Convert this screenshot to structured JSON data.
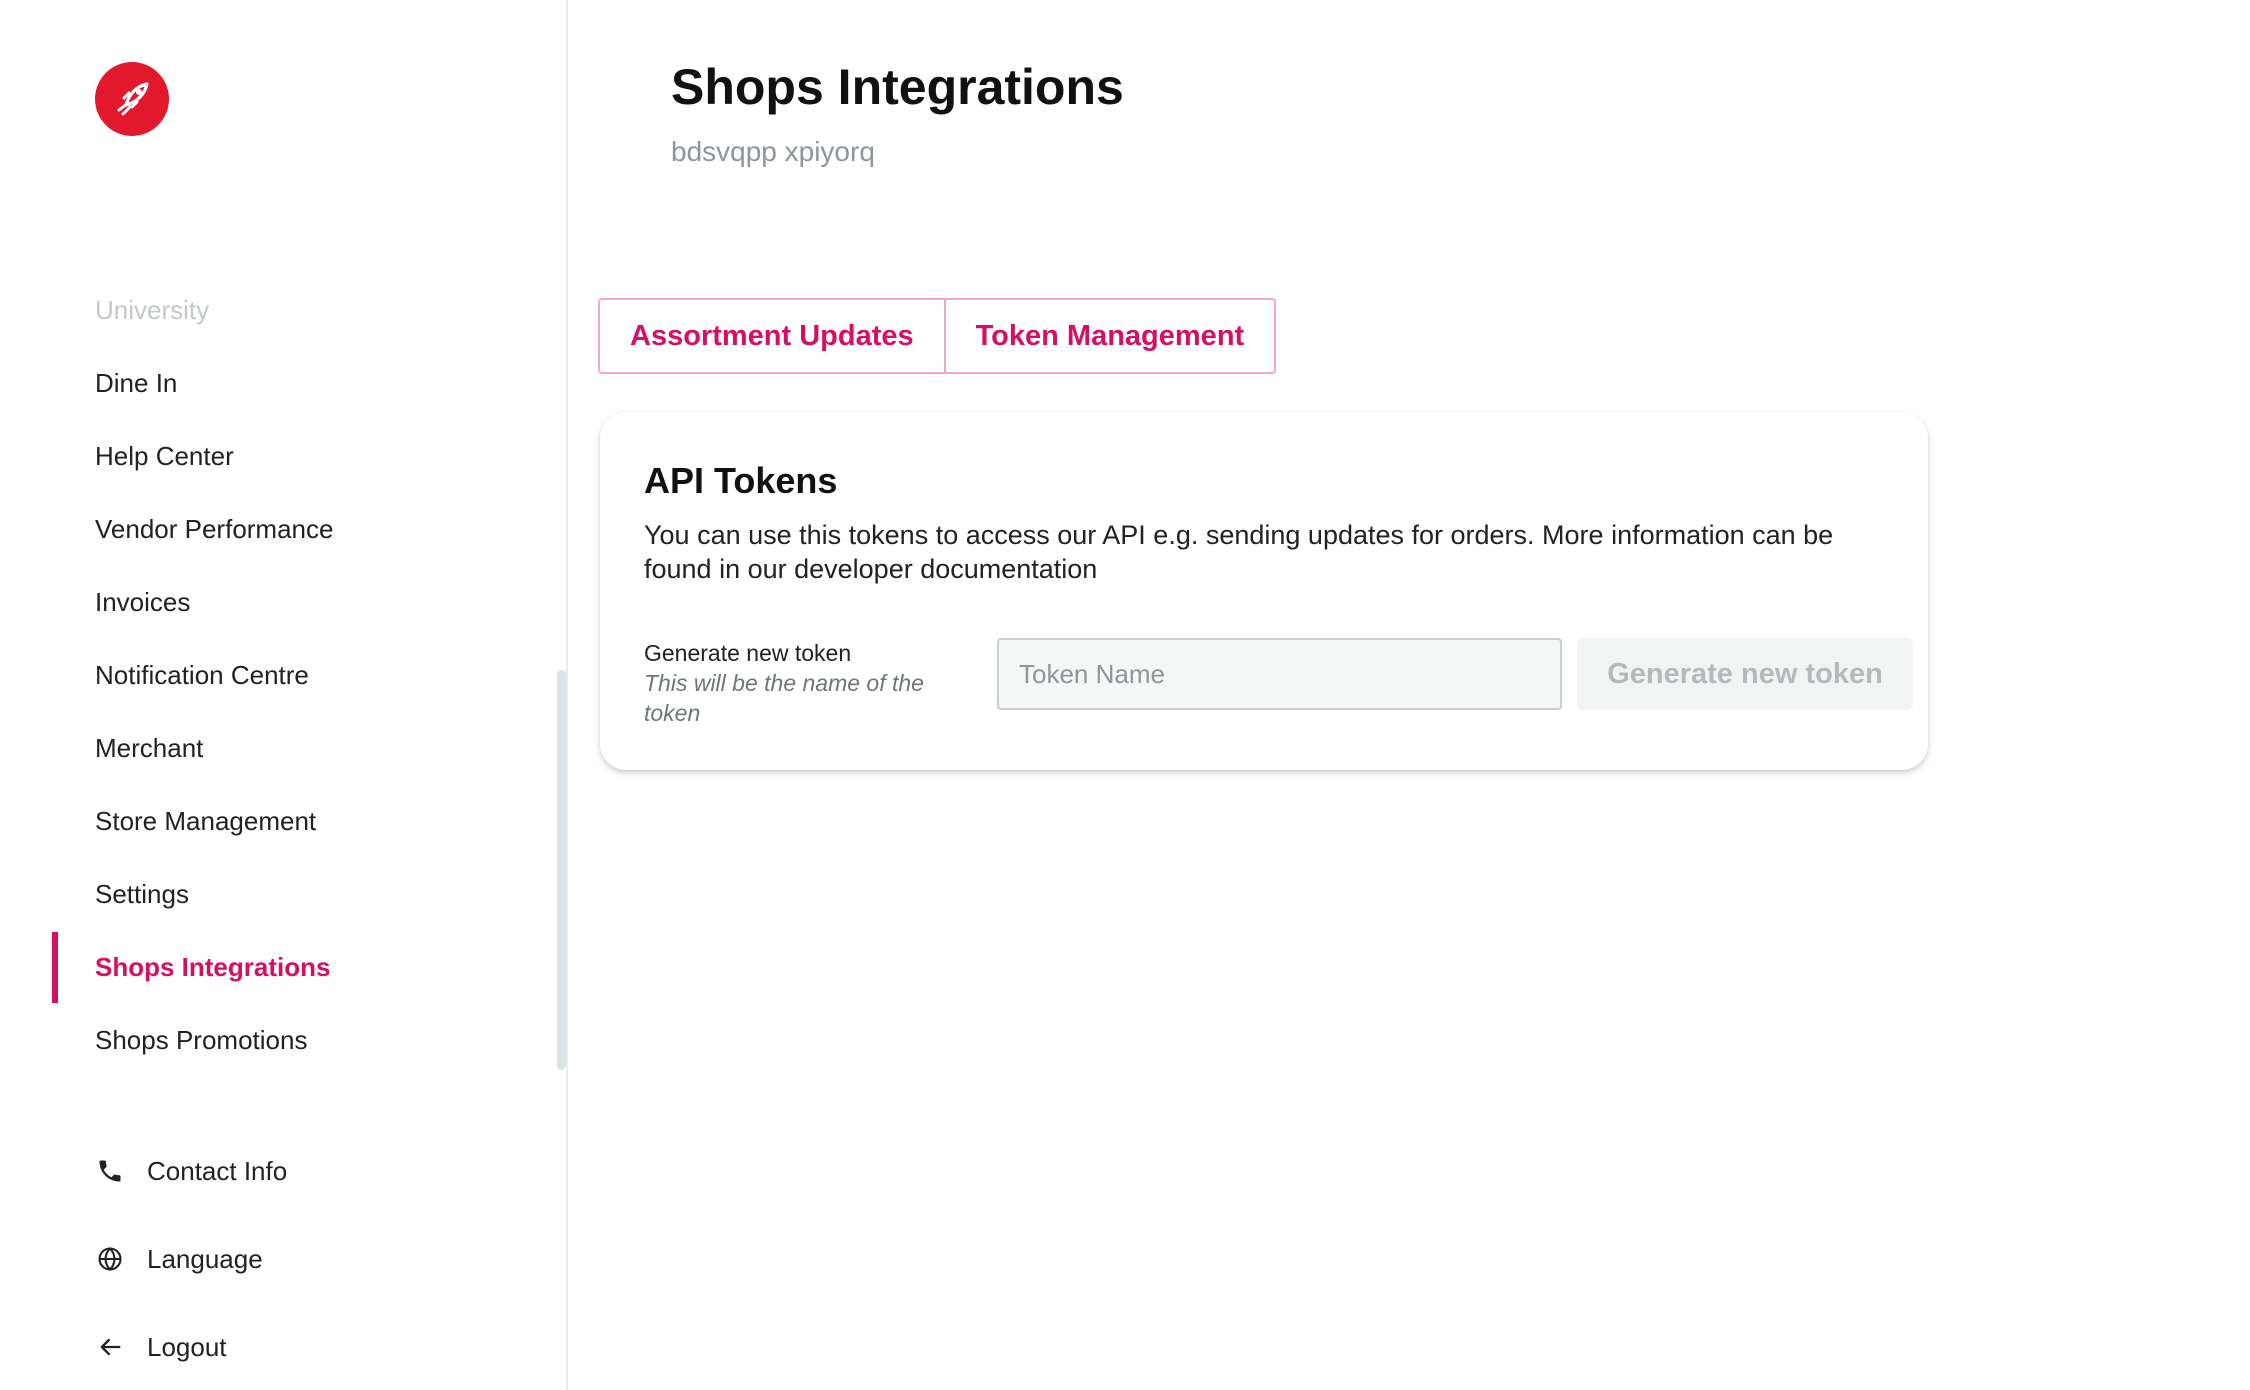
{
  "brand": {
    "color": "#e2192c",
    "accent": "#d70f64",
    "logo_icon": "rocket-icon"
  },
  "sidebar": {
    "items": [
      {
        "label": "University"
      },
      {
        "label": "Dine In"
      },
      {
        "label": "Help Center"
      },
      {
        "label": "Vendor Performance"
      },
      {
        "label": "Invoices"
      },
      {
        "label": "Notification Centre"
      },
      {
        "label": "Merchant"
      },
      {
        "label": "Store Management"
      },
      {
        "label": "Settings"
      },
      {
        "label": "Shops Integrations",
        "active": true
      },
      {
        "label": "Shops Promotions"
      }
    ],
    "bottom": [
      {
        "label": "Contact Info",
        "icon": "phone-icon"
      },
      {
        "label": "Language",
        "icon": "globe-icon"
      },
      {
        "label": "Logout",
        "icon": "arrow-left-icon"
      }
    ]
  },
  "header": {
    "title": "Shops Integrations",
    "subtitle": "bdsvqpp xpiyorq"
  },
  "tabs": [
    {
      "label": "Assortment Updates"
    },
    {
      "label": "Token Management"
    }
  ],
  "api_tokens": {
    "title": "API Tokens",
    "description": "You can use this tokens to access our API e.g. sending updates for orders. More information can be found in our developer documentation",
    "generate_label": "Generate new token",
    "generate_hint": "This will be the name of the token",
    "input_placeholder": "Token Name",
    "input_value": "",
    "button_label": "Generate new token"
  }
}
